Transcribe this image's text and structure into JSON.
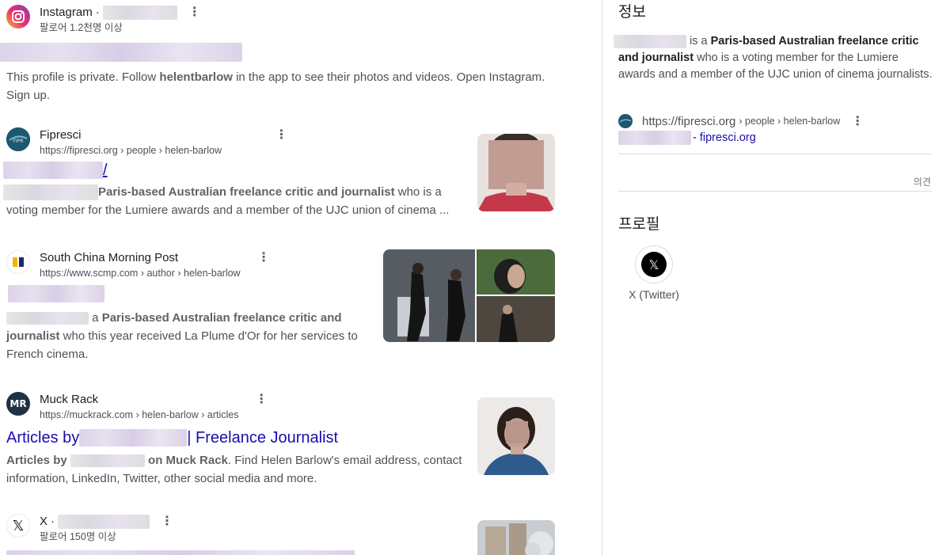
{
  "results": [
    {
      "source": "Instagram",
      "source_suffix": "·",
      "sub": "팔로어 1.2천명 이상",
      "snippet_pre": "This profile is private. Follow ",
      "snippet_bold": "helentbarlow",
      "snippet_post": " in the app to see their photos and videos. Open Instagram. Sign up."
    },
    {
      "source": "Fipresci",
      "url": "https://fipresci.org",
      "crumbs": " › people › helen-barlow",
      "title_fragment": "/",
      "snippet_bold": "Paris-based Australian freelance critic and journalist",
      "snippet_post": " who is a voting member for the Lumiere awards and a member of the UJC union of cinema ..."
    },
    {
      "source": "South China Morning Post",
      "url": "https://www.scmp.com",
      "crumbs": " › author › helen-barlow",
      "snippet_pre": " a ",
      "snippet_bold1": "Paris-based Australian freelance critic and",
      "snippet_bold2": "journalist",
      "snippet_post": " who this year received La Plume d'Or for her services to French cinema."
    },
    {
      "source": "Muck Rack",
      "url": "https://muckrack.com",
      "crumbs": " › helen-barlow › articles",
      "title_pre": "Articles by ",
      "title_post": " | Freelance Journalist",
      "snippet_bold1": "Articles by ",
      "snippet_bold2": " on Muck Rack",
      "snippet_post": ". Find Helen Barlow's email address, contact information, LinkedIn, Twitter, other social media and more."
    },
    {
      "source": "X",
      "source_suffix": "·",
      "sub": "팔로어 150명 이상"
    }
  ],
  "panel": {
    "title": "정보",
    "desc_pre": "is a ",
    "desc_bold": "Paris-based Australian freelance critic and journalist",
    "desc_post": " who is a voting member for the Lumiere awards and a member of the UJC union of cinema journalists.",
    "src_url": "https://fipresci.org",
    "src_crumbs": "› people › helen-barlow",
    "link_suffix": "- fipresci.org",
    "feedback": "의견",
    "profile_heading": "프로필",
    "profile_label": "X (Twitter)"
  },
  "icons": {
    "more": "⋮",
    "x_logo": "𝕏"
  }
}
